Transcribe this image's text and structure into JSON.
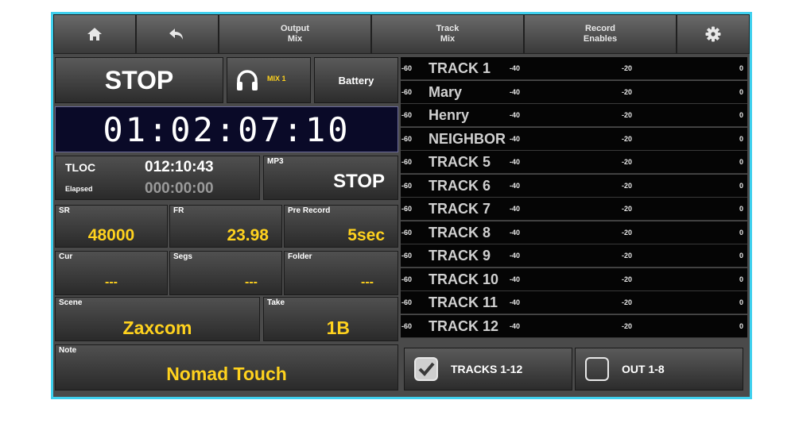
{
  "colors": {
    "frame": "#3fd0ee",
    "accent_yellow": "#ffd21e",
    "timecode_bg": "#0a0a28"
  },
  "topbar": {
    "home_icon": "home-icon",
    "back_icon": "back-arrow-icon",
    "output_mix": {
      "line1": "Output",
      "line2": "Mix"
    },
    "track_mix": {
      "line1": "Track",
      "line2": "Mix"
    },
    "record_enables": {
      "line1": "Record",
      "line2": "Enables"
    },
    "settings_icon": "gear-icon"
  },
  "transport": {
    "state": "STOP",
    "headphone_icon": "headphones-icon",
    "mix_label": "MIX 1",
    "battery_label": "Battery"
  },
  "timecode": "01:02:07:10",
  "tloc": {
    "label": "TLOC",
    "value": "012:10:43",
    "elapsed_label": "Elapsed",
    "elapsed_value": "000:00:00"
  },
  "mp3": {
    "label": "MP3",
    "state": "STOP"
  },
  "info": {
    "sr": {
      "label": "SR",
      "value": "48000"
    },
    "fr": {
      "label": "FR",
      "value": "23.98"
    },
    "prerecord": {
      "label": "Pre Record",
      "value": "5sec"
    },
    "cur": {
      "label": "Cur",
      "value": "---"
    },
    "segs": {
      "label": "Segs",
      "value": "---"
    },
    "folder": {
      "label": "Folder",
      "value": "---"
    },
    "scene": {
      "label": "Scene",
      "value": "Zaxcom"
    },
    "take": {
      "label": "Take",
      "value": "1B"
    },
    "note": {
      "label": "Note",
      "value": "Nomad Touch"
    }
  },
  "meter_scale": {
    "min": "-60",
    "mid1": "-40",
    "mid2": "-20",
    "max": "0"
  },
  "tracks": [
    "TRACK 1",
    "Mary",
    "Henry",
    "NEIGHBOR",
    "TRACK 5",
    "TRACK 6",
    "TRACK 7",
    "TRACK 8",
    "TRACK 9",
    "TRACK 10",
    "TRACK 11",
    "TRACK 12"
  ],
  "bottom": {
    "tracks_toggle": {
      "label": "TRACKS 1-12",
      "checked": true
    },
    "out_toggle": {
      "label": "OUT 1-8",
      "checked": false
    }
  }
}
